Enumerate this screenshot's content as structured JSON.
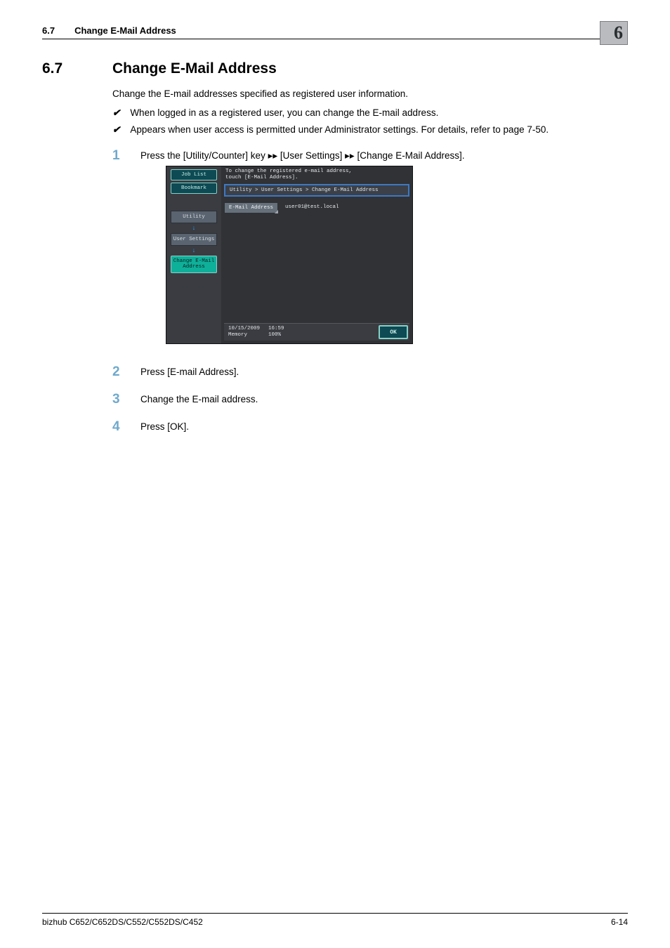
{
  "header": {
    "section_number": "6.7",
    "section_title": "Change E-Mail Address",
    "chapter_number": "6"
  },
  "heading": {
    "number": "6.7",
    "title": "Change E-Mail Address"
  },
  "intro": "Change the E-mail addresses specified as registered user information.",
  "checks": [
    "When logged in as a registered user, you can change the E-mail address.",
    "Appears when user access is permitted under Administrator settings. For details, refer to page 7-50."
  ],
  "steps": [
    {
      "num": "1",
      "text": "Press the [Utility/Counter] key ▸▸ [User Settings] ▸▸ [Change E-Mail Address]."
    },
    {
      "num": "2",
      "text": "Press [E-mail Address]."
    },
    {
      "num": "3",
      "text": "Change the E-mail address."
    },
    {
      "num": "4",
      "text": "Press [OK]."
    }
  ],
  "screenshot": {
    "tabs": {
      "job_list": "Job List",
      "bookmark": "Bookmark"
    },
    "left": {
      "utility": "Utility",
      "user_settings": "User Settings",
      "change_email": "Change E-Mail\nAddress"
    },
    "instruction": "To change the registered e-mail address,\ntouch [E-Mail Address].",
    "breadcrumb": "Utility > User Settings > Change E-Mail Address",
    "field_label": "E-Mail Address",
    "field_value": "user01@test.local",
    "status": {
      "date": "10/15/2009",
      "time": "16:59",
      "memory_label": "Memory",
      "memory_value": "100%"
    },
    "ok": "OK"
  },
  "footer": {
    "model": "bizhub C652/C652DS/C552/C552DS/C452",
    "page": "6-14"
  }
}
